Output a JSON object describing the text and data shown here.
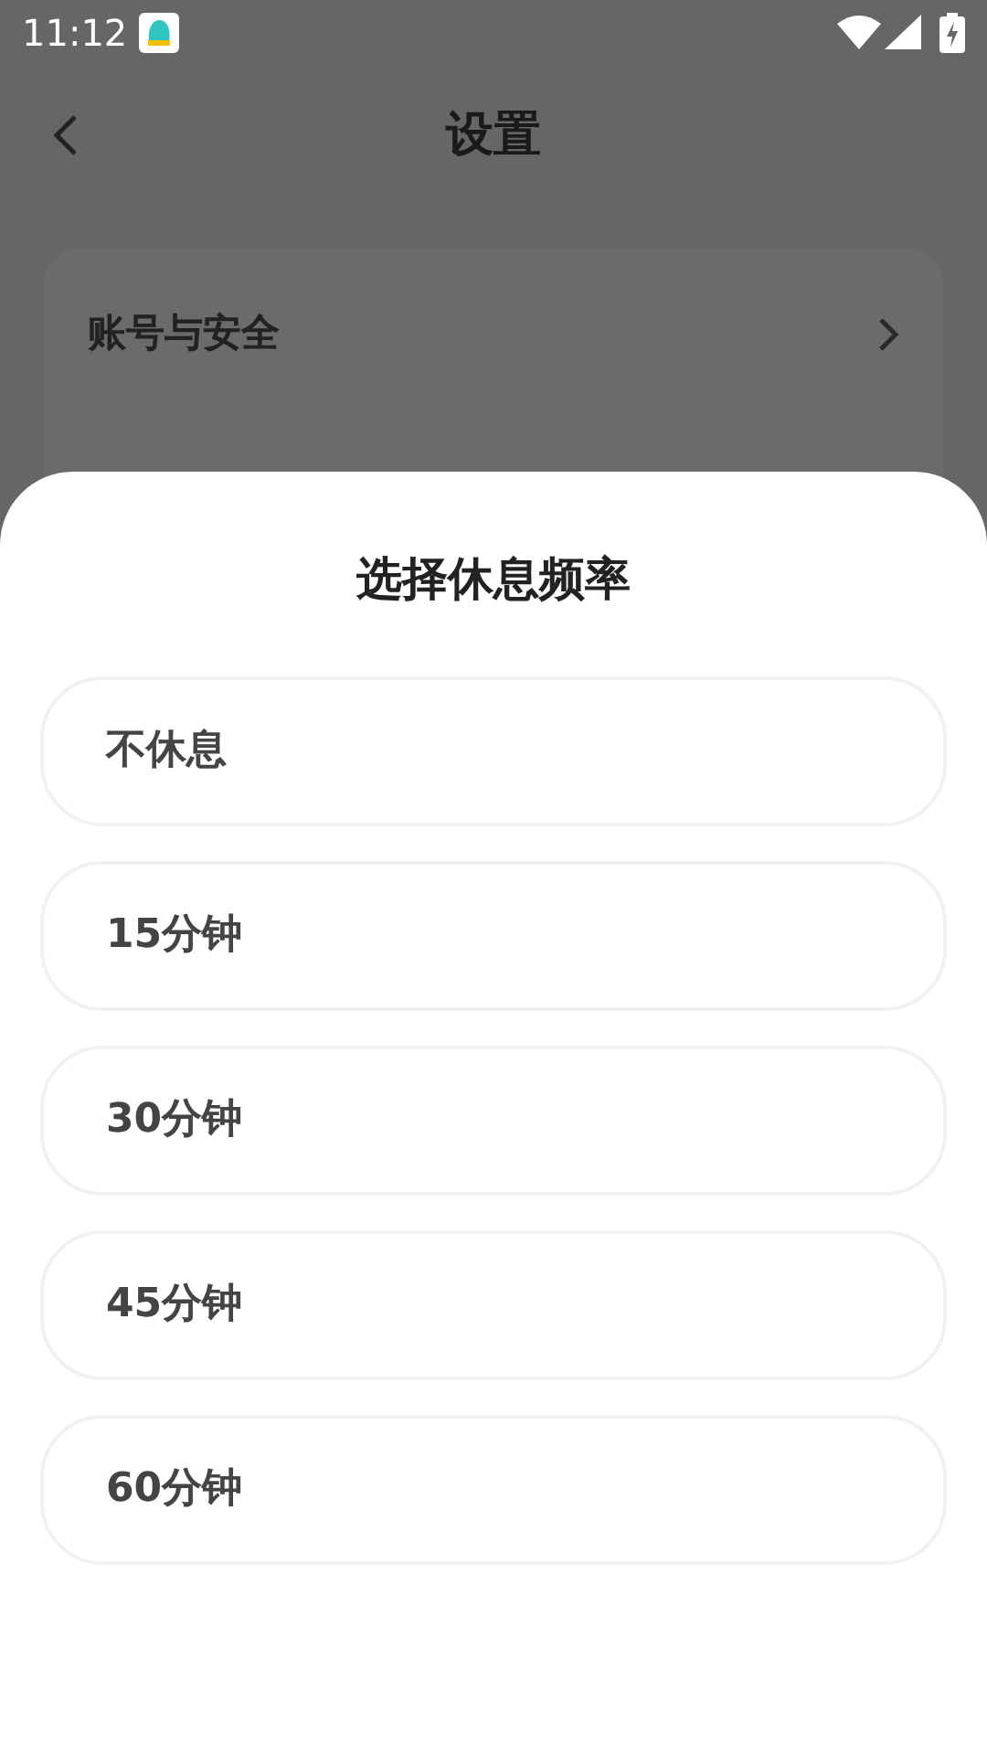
{
  "status_bar": {
    "time": "11:12"
  },
  "header": {
    "title": "设置"
  },
  "settings_items": [
    {
      "label": "账号与安全"
    }
  ],
  "sheet": {
    "title": "选择休息频率",
    "options": [
      {
        "label": "不休息"
      },
      {
        "label": "15分钟"
      },
      {
        "label": "30分钟"
      },
      {
        "label": "45分钟"
      },
      {
        "label": "60分钟"
      }
    ]
  }
}
